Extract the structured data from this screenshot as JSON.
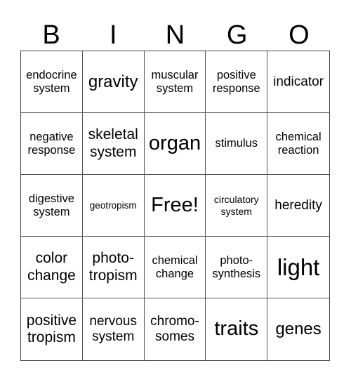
{
  "header": [
    "B",
    "I",
    "N",
    "G",
    "O"
  ],
  "cells": [
    "endocrine system",
    "gravity",
    "muscular system",
    "positive response",
    "indicator",
    "negative response",
    "skeletal system",
    "organ",
    "stimulus",
    "chemical reaction",
    "digestive system",
    "geotropism",
    "Free!",
    "circulatory system",
    "heredity",
    "color change",
    "photo-tropism",
    "chemical change",
    "photo-synthesis",
    "light",
    "positive tropism",
    "nervous system",
    "chromo-somes",
    "traits",
    "genes"
  ]
}
